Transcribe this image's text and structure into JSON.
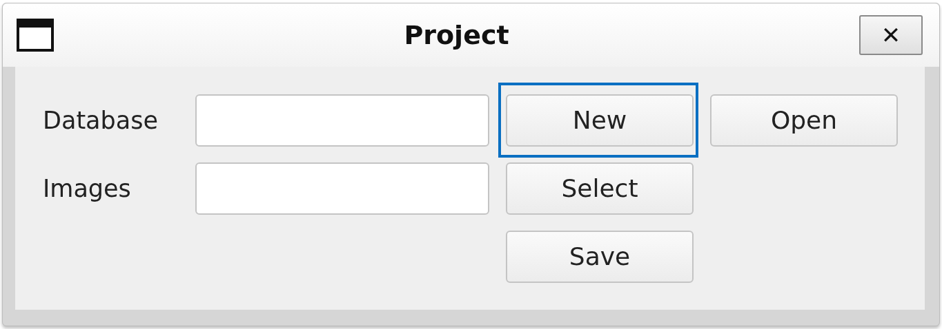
{
  "window": {
    "title": "Project",
    "close": "✕"
  },
  "fields": [
    {
      "label": "Database"
    },
    {
      "label": "Images"
    }
  ],
  "buttons": [
    {
      "label": "New",
      "focused": true
    },
    {
      "label": "Open",
      "focused": false
    },
    {
      "label": "Select",
      "focused": false
    },
    {
      "label": "Save",
      "focused": false
    }
  ]
}
